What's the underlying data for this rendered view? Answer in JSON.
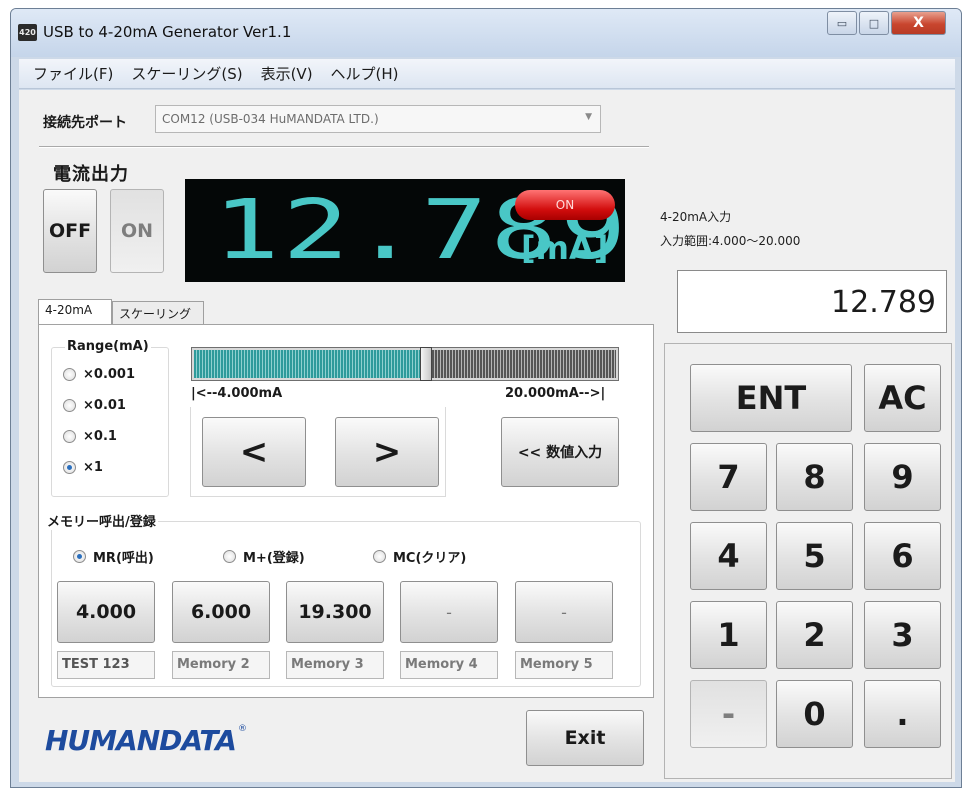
{
  "window": {
    "icon_text": "420",
    "title": "USB to 4-20mA Generator  Ver1.1",
    "controls": {
      "minimize": "▭",
      "maximize": "□",
      "close": "X"
    }
  },
  "menu": [
    "ファイル(F)",
    "スケーリング(S)",
    "表示(V)",
    "ヘルプ(H)"
  ],
  "port": {
    "label": "接続先ポート",
    "value": "COM12 (USB-034 HuMANDATA LTD.)"
  },
  "output": {
    "title": "電流出力",
    "off_label": "OFF",
    "on_label": "ON",
    "display_value": "12.789",
    "status_pill": "ON",
    "unit": "[mA]"
  },
  "tabs": [
    "4-20mA",
    "スケーリング"
  ],
  "range": {
    "title": "Range(mA)",
    "options": [
      "×0.001",
      "×0.01",
      "×0.1",
      "×1"
    ],
    "selected": 3
  },
  "slider": {
    "value": 12.789,
    "min": 4.0,
    "max": 20.0,
    "left_label": "|<--4.000mA",
    "right_label": "20.000mA-->|"
  },
  "steppers": {
    "dec_label": "<",
    "inc_label": ">"
  },
  "numeric_input_label": "<< 数値入力",
  "memory": {
    "title": "メモリー呼出/登録",
    "modes": [
      "MR(呼出)",
      "M+(登録)",
      "MC(クリア)"
    ],
    "selected_mode": 0,
    "slots": [
      {
        "value": "4.000",
        "name": "TEST 123"
      },
      {
        "value": "6.000",
        "name": "Memory 2"
      },
      {
        "value": "19.300",
        "name": "Memory 3"
      },
      {
        "value": "-",
        "name": "Memory 4"
      },
      {
        "value": "-",
        "name": "Memory 5"
      }
    ]
  },
  "logo": {
    "text": "HUMANDATA",
    "mark": "®"
  },
  "exit_label": "Exit",
  "input": {
    "label": "4-20mA入力",
    "range_label": "入力範囲:4.000〜20.000",
    "value": "12.789"
  },
  "keypad": {
    "ent": "ENT",
    "ac": "AC",
    "rows": [
      [
        "7",
        "8",
        "9"
      ],
      [
        "4",
        "5",
        "6"
      ],
      [
        "1",
        "2",
        "3"
      ],
      [
        "-",
        "0",
        "."
      ]
    ]
  },
  "colors": {
    "display_bg": "#040707",
    "segment": "#49c7c6",
    "on_pill": "#d20d0d",
    "logo": "#1d4b9e",
    "frame": "#cdd9e8"
  }
}
